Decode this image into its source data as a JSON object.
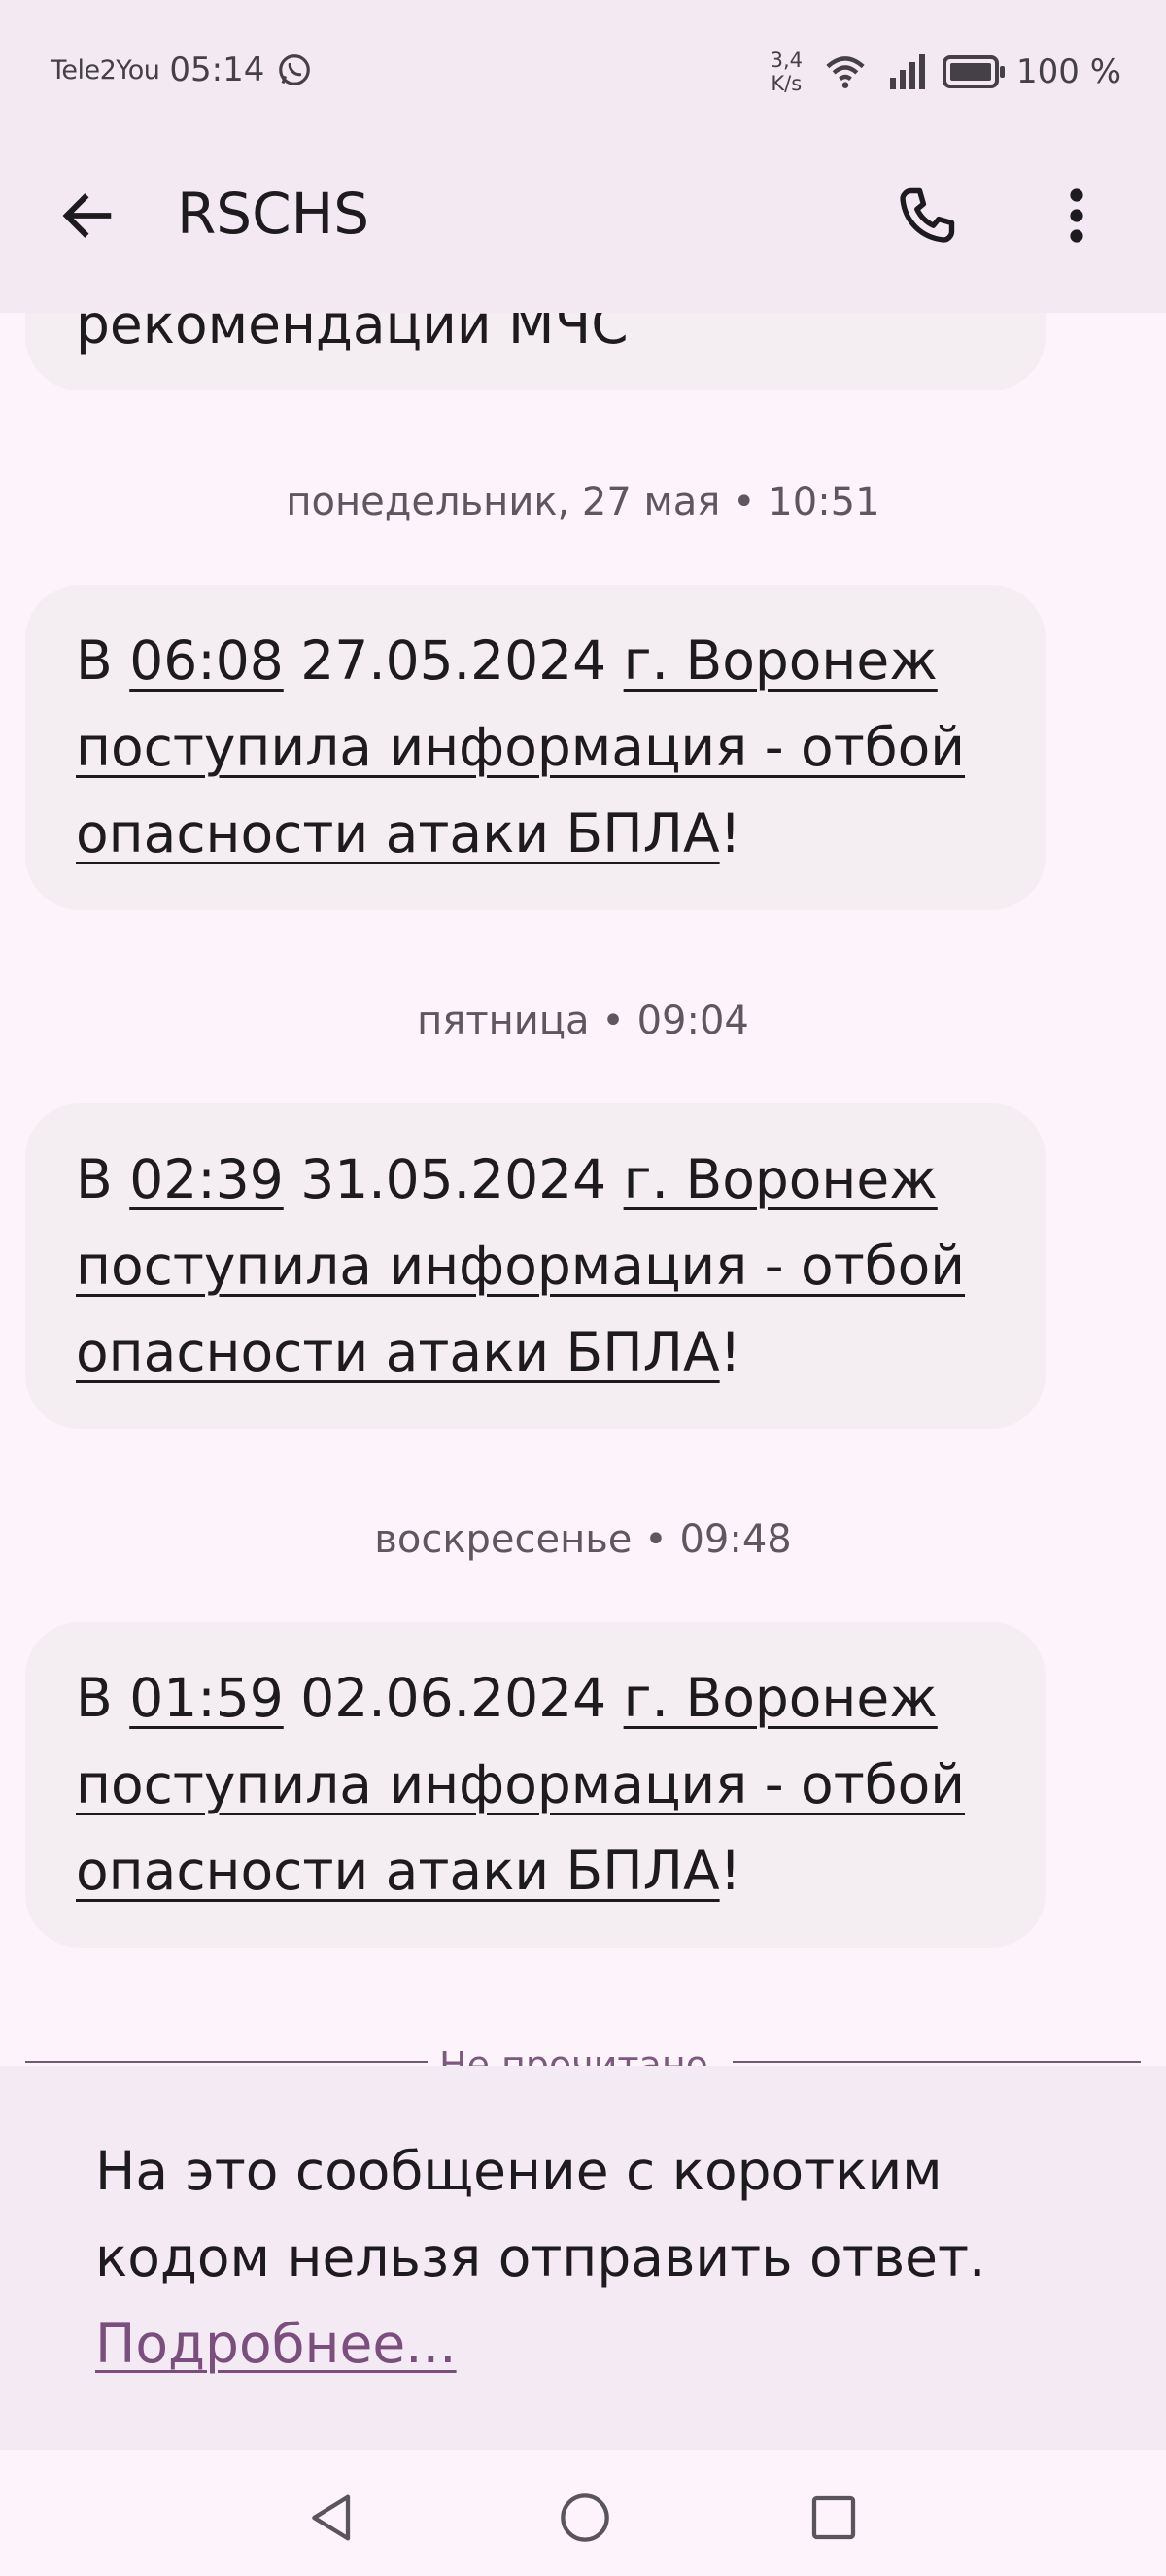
{
  "status_bar": {
    "carrier": "Tele2You",
    "time": "05:14",
    "net_speed_value": "3,4",
    "net_speed_unit": "K/s",
    "battery": "100 %"
  },
  "app_bar": {
    "title": "RSCHS"
  },
  "messages": [
    {
      "partial_text": "рекомендации МЧС"
    },
    {
      "date": "понедельник, 27 мая • 10:51",
      "prefix": "В",
      "time_link": "06:08",
      "date_text": "27.05.2024",
      "city_link": "г. Воронеж",
      "line2": "поступила информация - отбой",
      "line3_link": "опасности атаки БПЛА",
      "line3_end": "!"
    },
    {
      "date": "пятница • 09:04",
      "prefix": "В",
      "time_link": "02:39",
      "date_text": "31.05.2024",
      "city_link": "г. Воронеж",
      "line2": "поступила информация - отбой",
      "line3_link": "опасности атаки БПЛА",
      "line3_end": "!"
    },
    {
      "date": "воскресенье • 09:48",
      "prefix": "В",
      "time_link": "01:59",
      "date_text": "02.06.2024",
      "city_link": "г. Воронеж",
      "line2": "поступила информация - отбой",
      "line3_link": "опасности атаки БПЛА",
      "line3_end": "!"
    }
  ],
  "unread_label": "Не прочитано",
  "reply_notice": {
    "text": "На это сообщение с коротким кодом нельзя отправить ответ.",
    "link": "Подробнее..."
  }
}
